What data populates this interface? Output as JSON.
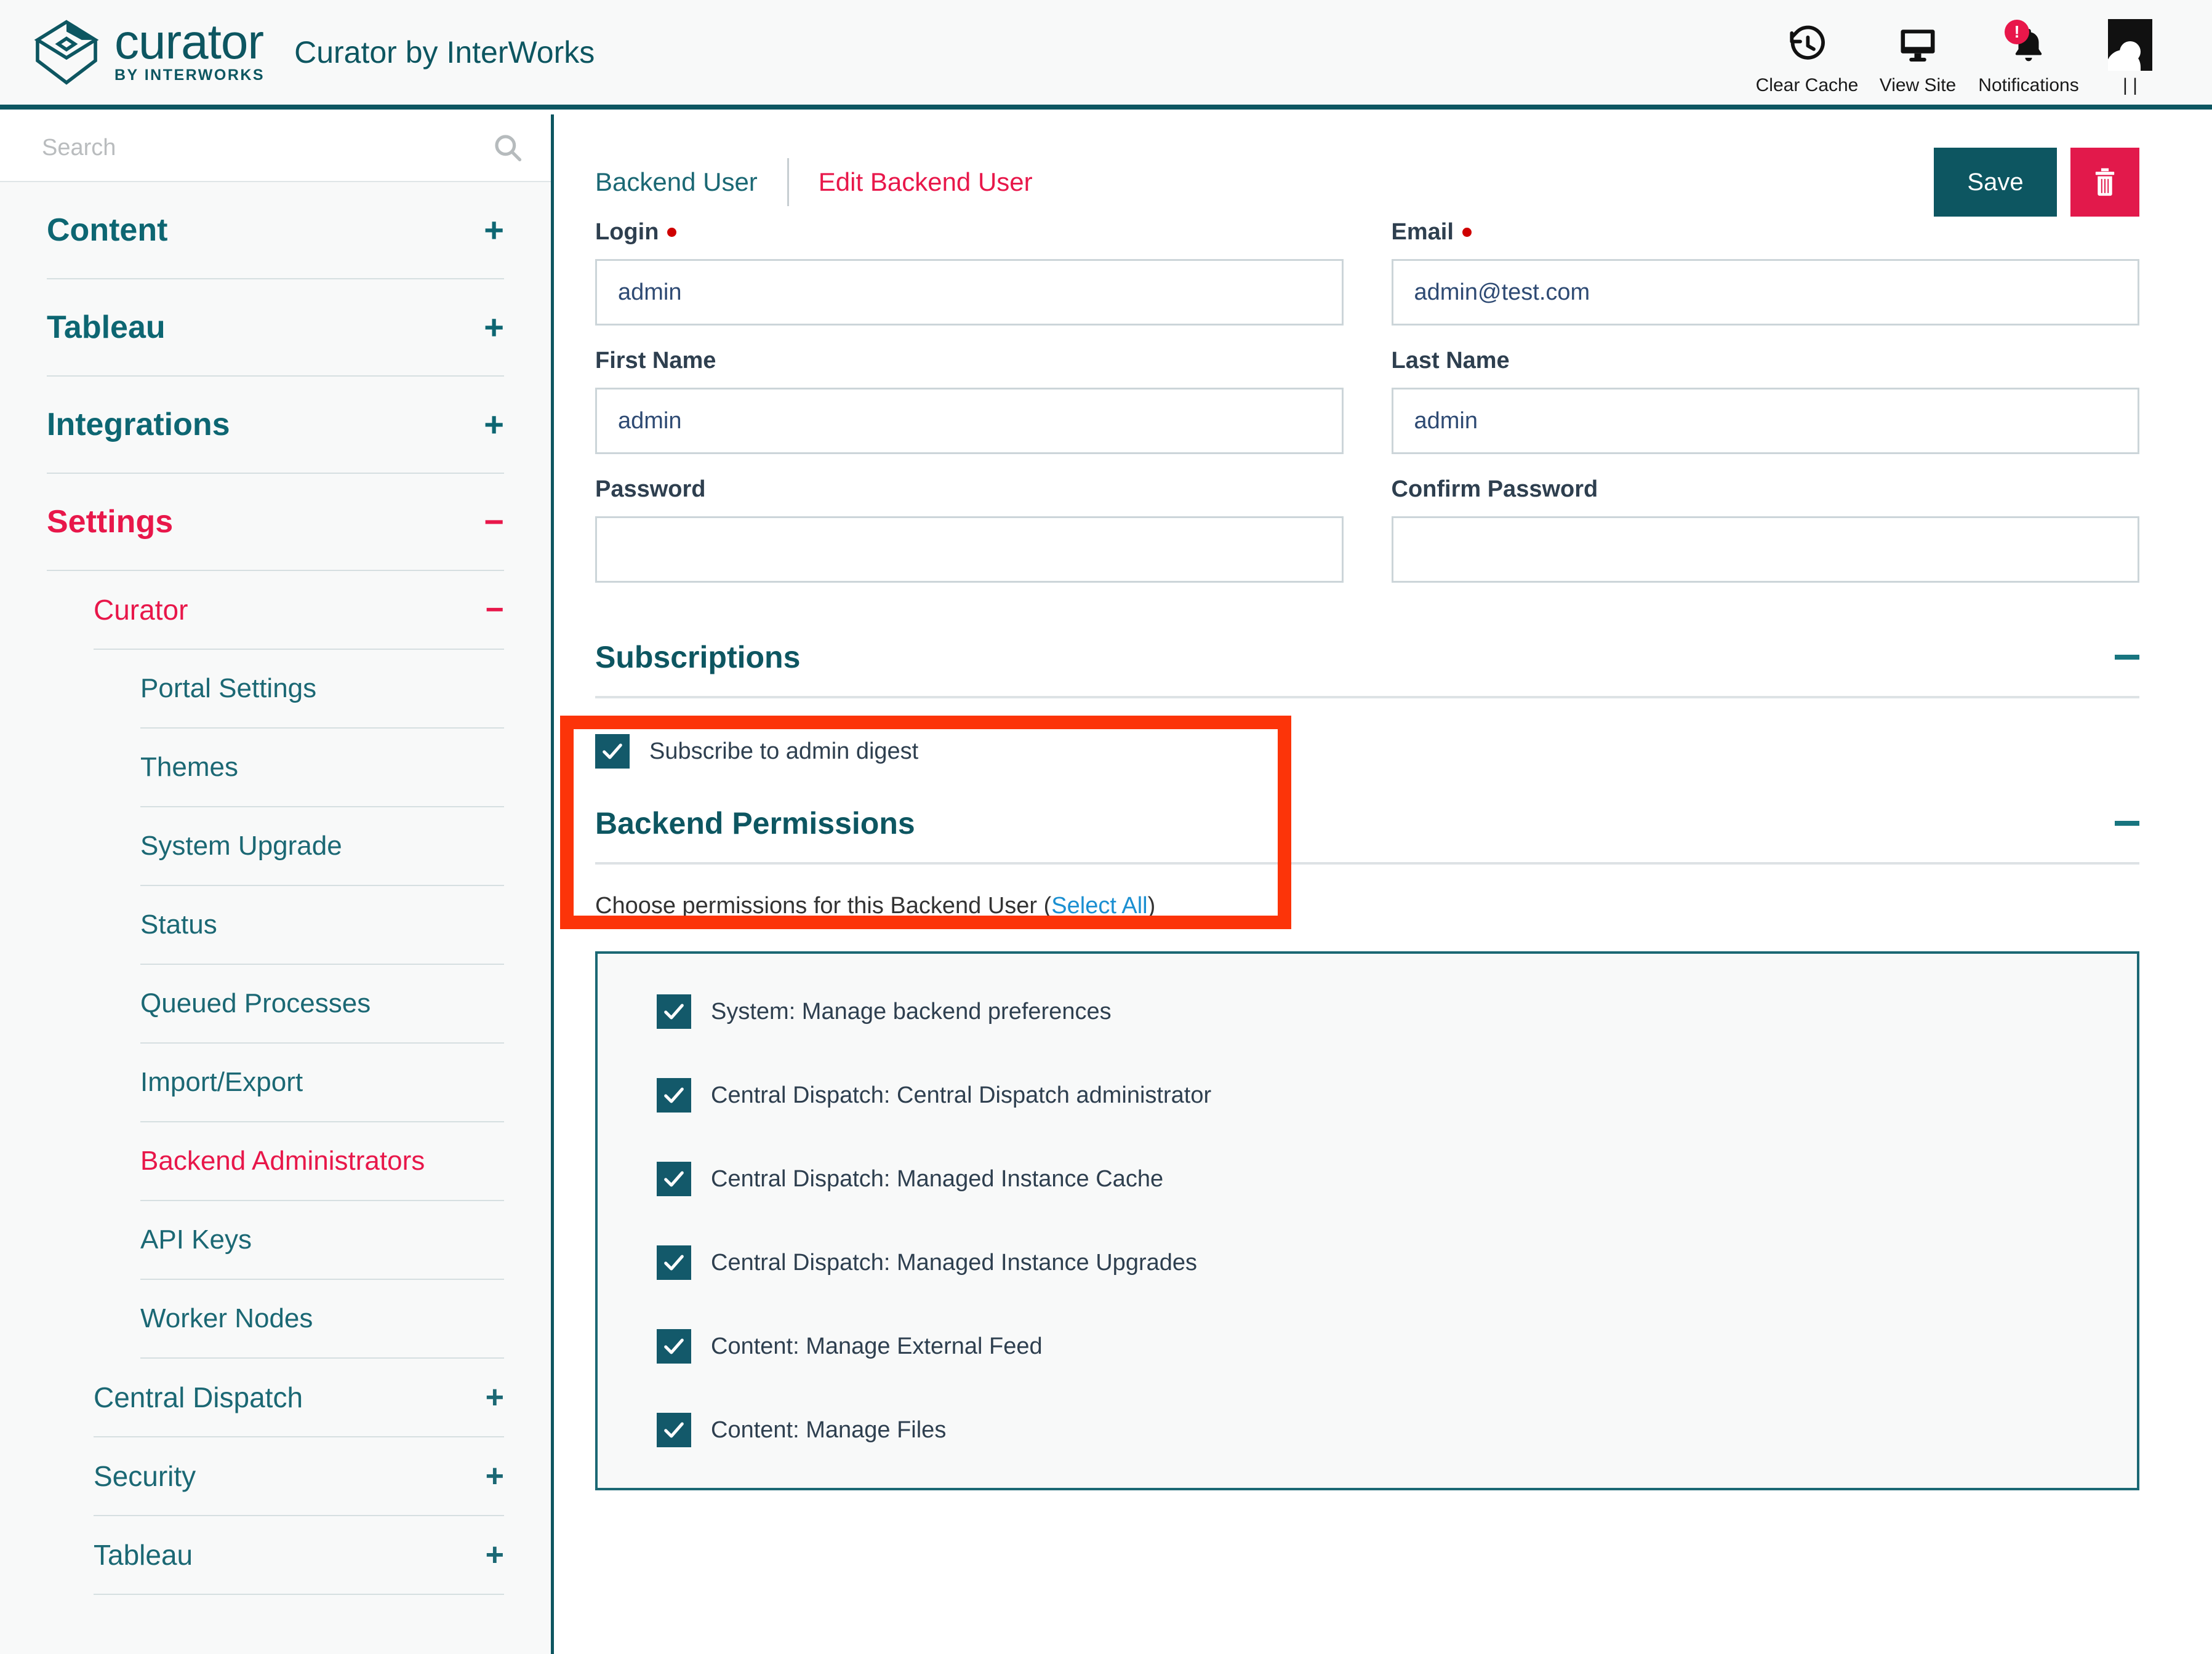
{
  "header": {
    "logo_word": "curator",
    "logo_byline": "BY INTERWORKS",
    "app_title": "Curator by InterWorks",
    "actions": [
      {
        "label": "Clear Cache",
        "icon": "clear-cache-icon"
      },
      {
        "label": "View Site",
        "icon": "view-site-icon"
      },
      {
        "label": "Notifications",
        "icon": "notifications-bell-icon",
        "badge": "!"
      }
    ],
    "account_label": "| |"
  },
  "sidebar": {
    "search_placeholder": "Search",
    "search_value": "",
    "groups": [
      {
        "label": "Content",
        "sign": "+",
        "active": false
      },
      {
        "label": "Tableau",
        "sign": "+",
        "active": false
      },
      {
        "label": "Integrations",
        "sign": "+",
        "active": false
      },
      {
        "label": "Settings",
        "sign": "−",
        "active": true
      }
    ],
    "settings_sub": {
      "label": "Curator",
      "sign": "−",
      "active": true
    },
    "curator_items": [
      {
        "label": "Portal Settings",
        "active": false
      },
      {
        "label": "Themes",
        "active": false
      },
      {
        "label": "System Upgrade",
        "active": false
      },
      {
        "label": "Status",
        "active": false
      },
      {
        "label": "Queued Processes",
        "active": false
      },
      {
        "label": "Import/Export",
        "active": false
      },
      {
        "label": "Backend Administrators",
        "active": true
      },
      {
        "label": "API Keys",
        "active": false
      },
      {
        "label": "Worker Nodes",
        "active": false
      }
    ],
    "settings_more": [
      {
        "label": "Central Dispatch",
        "sign": "+"
      },
      {
        "label": "Security",
        "sign": "+"
      },
      {
        "label": "Tableau",
        "sign": "+"
      }
    ]
  },
  "main": {
    "breadcrumb": {
      "parent": "Backend User",
      "current": "Edit Backend User"
    },
    "save_label": "Save",
    "delete_icon": "trash-icon",
    "fields": {
      "login": {
        "label": "Login",
        "required": true,
        "value": "admin",
        "placeholder": ""
      },
      "email": {
        "label": "Email",
        "required": true,
        "value": "admin@test.com",
        "placeholder": ""
      },
      "first_name": {
        "label": "First Name",
        "required": false,
        "value": "admin",
        "placeholder": ""
      },
      "last_name": {
        "label": "Last Name",
        "required": false,
        "value": "admin",
        "placeholder": ""
      },
      "password": {
        "label": "Password",
        "required": false,
        "value": "",
        "placeholder": ""
      },
      "confirm_password": {
        "label": "Confirm Password",
        "required": false,
        "value": "",
        "placeholder": ""
      }
    },
    "subscriptions": {
      "title": "Subscriptions",
      "collapse_icon": "minus-icon",
      "items": [
        {
          "label": "Subscribe to admin digest",
          "checked": true
        }
      ]
    },
    "permissions": {
      "title": "Backend Permissions",
      "collapse_icon": "minus-icon",
      "description_prefix": "Choose permissions for this Backend User (",
      "select_all_label": "Select All",
      "description_suffix": ")",
      "items": [
        {
          "label": "System: Manage backend preferences",
          "checked": true
        },
        {
          "label": "Central Dispatch: Central Dispatch administrator",
          "checked": true
        },
        {
          "label": "Central Dispatch: Managed Instance Cache",
          "checked": true
        },
        {
          "label": "Central Dispatch: Managed Instance Upgrades",
          "checked": true
        },
        {
          "label": "Content: Manage External Feed",
          "checked": true
        },
        {
          "label": "Content: Manage Files",
          "checked": true
        }
      ]
    }
  },
  "annotation": {
    "color": "#fc3409",
    "target": "subscriptions-section"
  },
  "colors": {
    "teal": "#0d5661",
    "teal_light": "#1b6874",
    "crimson": "#e8174a",
    "annotation_red": "#fc3409",
    "link_blue": "#1a8fd1"
  }
}
